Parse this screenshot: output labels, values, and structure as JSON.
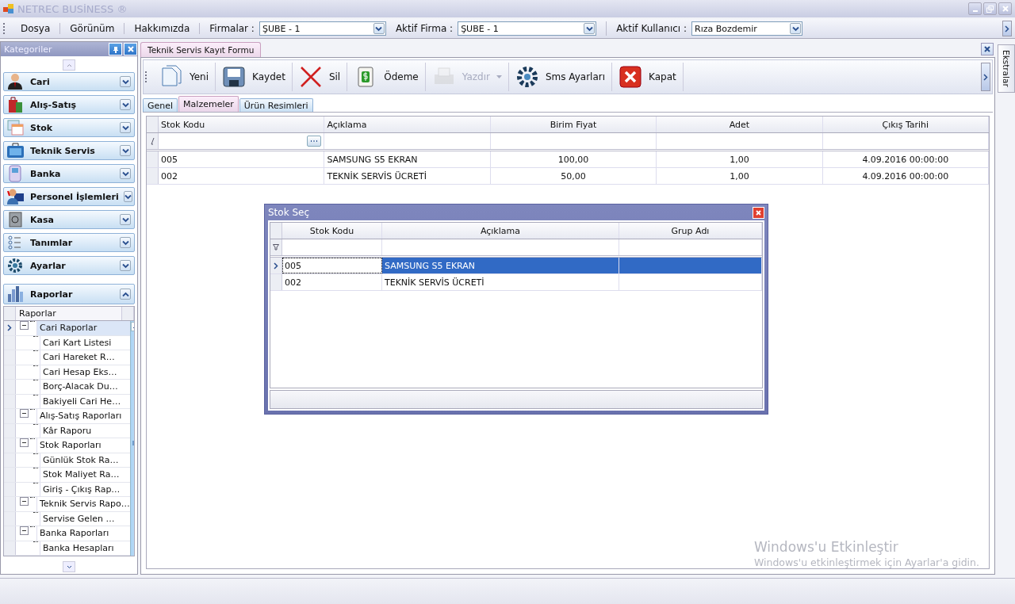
{
  "window": {
    "title": "NETREC BUSİNESS ®"
  },
  "menu": {
    "items": [
      "Dosya",
      "Görünüm",
      "Hakkımızda"
    ],
    "combos": [
      {
        "label": "Firmalar :",
        "value": "ŞUBE - 1"
      },
      {
        "label": "Aktif Firma :",
        "value": "ŞUBE - 1"
      },
      {
        "label": "Aktif Kullanıcı :",
        "value": "Rıza Bozdemir"
      }
    ]
  },
  "sidebar": {
    "title": "Kategoriler",
    "categories": [
      {
        "label": "Cari",
        "expanded": false
      },
      {
        "label": "Alış-Satış",
        "expanded": false
      },
      {
        "label": "Stok",
        "expanded": false
      },
      {
        "label": "Teknik Servis",
        "expanded": false
      },
      {
        "label": "Banka",
        "expanded": false
      },
      {
        "label": "Personel İşlemleri",
        "expanded": false
      },
      {
        "label": "Kasa",
        "expanded": false
      },
      {
        "label": "Tanımlar",
        "expanded": false
      },
      {
        "label": "Ayarlar",
        "expanded": false
      },
      {
        "label": "Raporlar",
        "expanded": true
      }
    ],
    "tree": {
      "column": "Raporlar",
      "items": [
        {
          "label": "Cari Raporlar",
          "selected": true,
          "expanded": true,
          "children": [
            {
              "label": "Cari Kart Listesi",
              "selected": false
            },
            {
              "label": "Cari Hareket R…",
              "selected": false
            },
            {
              "label": "Cari Hesap Eks…",
              "selected": false
            },
            {
              "label": "Borç-Alacak Du…",
              "selected": false
            },
            {
              "label": "Bakiyeli Cari He…",
              "selected": false
            }
          ]
        },
        {
          "label": "Alış-Satış Raporları",
          "selected": false,
          "expanded": true,
          "children": [
            {
              "label": "Kâr Raporu",
              "selected": false
            }
          ]
        },
        {
          "label": "Stok Raporları",
          "selected": false,
          "expanded": true,
          "children": [
            {
              "label": "Günlük Stok Ra…",
              "selected": false
            },
            {
              "label": "Stok Maliyet Ra…",
              "selected": false
            },
            {
              "label": "Giriş - Çıkış Rap…",
              "selected": false
            }
          ]
        },
        {
          "label": "Teknik Servis Rapo…",
          "selected": false,
          "expanded": true,
          "children": [
            {
              "label": "Servise Gelen …",
              "selected": false
            }
          ]
        },
        {
          "label": "Banka Raporları",
          "selected": false,
          "expanded": true,
          "children": [
            {
              "label": "Banka Hesapları",
              "selected": false
            }
          ]
        }
      ]
    }
  },
  "document_tab": {
    "title": "Teknik Servis Kayıt Formu"
  },
  "toolbar": [
    {
      "label": "Yeni",
      "disabled": false,
      "dropdown": false
    },
    {
      "label": "Kaydet",
      "disabled": false,
      "dropdown": false
    },
    {
      "label": "Sil",
      "disabled": false,
      "dropdown": false
    },
    {
      "label": "Ödeme",
      "disabled": false,
      "dropdown": false
    },
    {
      "label": "Yazdır",
      "disabled": true,
      "dropdown": true
    },
    {
      "label": "Sms Ayarları",
      "disabled": false,
      "dropdown": false
    },
    {
      "label": "Kapat",
      "disabled": false,
      "dropdown": false
    }
  ],
  "tabs": [
    {
      "label": "Genel",
      "selected": false
    },
    {
      "label": "Malzemeler",
      "selected": true
    },
    {
      "label": "Ürün Resimleri",
      "selected": false
    }
  ],
  "table": {
    "columns": [
      "Stok Kodu",
      "Açıklama",
      "Birim Fiyat",
      "Adet",
      "Çıkış Tarihi"
    ],
    "rows": [
      [
        "005",
        "SAMSUNG S5 EKRAN",
        "100,00",
        "1,00",
        "4.09.2016 00:00:00"
      ],
      [
        "002",
        "TEKNİK SERVİS ÜCRETİ",
        "50,00",
        "1,00",
        "4.09.2016 00:00:00"
      ]
    ]
  },
  "dialog": {
    "title": "Stok Seç",
    "columns": [
      "Stok Kodu",
      "Açıklama",
      "Grup Adı"
    ],
    "rows": [
      {
        "cells": [
          "005",
          "SAMSUNG S5 EKRAN"
        ],
        "selected": true
      },
      {
        "cells": [
          "002",
          "TEKNİK SERVİS ÜCRETİ"
        ],
        "selected": false
      }
    ]
  },
  "right_panel": {
    "label": "Ekstralar"
  },
  "activation_notice": {
    "title": "Windows'u Etkinleştir",
    "text": "Windows'u etkinleştirmek için Ayarlar'a gidin."
  }
}
